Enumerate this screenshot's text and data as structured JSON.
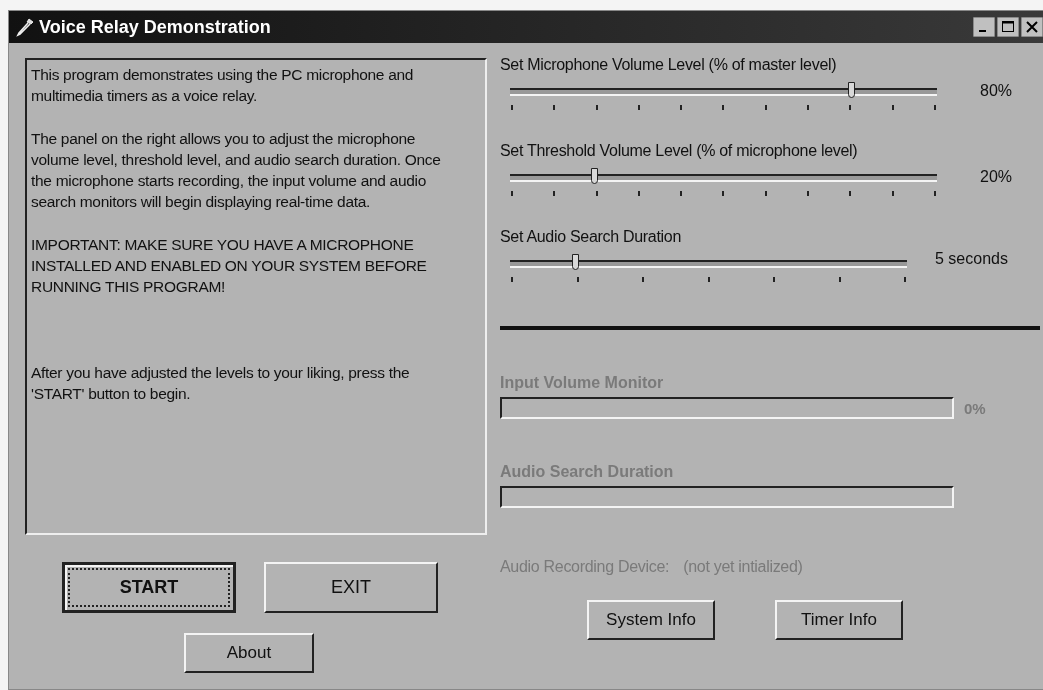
{
  "window": {
    "title": "Voice Relay Demonstration"
  },
  "description": [
    "This program demonstrates using the PC microphone and multimedia timers as a voice relay.",
    "The panel on the right allows you to adjust the microphone volume level, threshold level, and audio search duration.  Once the microphone starts recording, the input volume and audio search monitors will begin displaying real-time data.",
    "IMPORTANT:  MAKE SURE YOU HAVE A MICROPHONE INSTALLED AND ENABLED ON YOUR SYSTEM BEFORE RUNNING THIS PROGRAM!",
    "After you have adjusted the levels to your liking, press the 'START' button to begin."
  ],
  "buttons": [
    {
      "label": "START",
      "focused": true
    },
    {
      "label": "EXIT",
      "focused": false
    }
  ],
  "about_button": {
    "label": "About"
  },
  "sliders": [
    {
      "label": "Set Microphone Volume Level (% of master level)",
      "level": 0.8,
      "reading": "80%"
    },
    {
      "label": "Set Threshold Volume Level (% of microphone level)",
      "level": 0.2,
      "reading": "20%"
    },
    {
      "label": "Set Audio Search Duration",
      "level": 0.1667,
      "reading": "5 seconds"
    }
  ],
  "monitors": [
    {
      "label": "Input Volume Monitor",
      "disabled": true,
      "reading": "0%"
    },
    {
      "label": "Audio Search Duration",
      "disabled": true
    }
  ],
  "device": {
    "label": "Audio Recording Device:",
    "value": "(not yet intialized)",
    "disabled": true
  },
  "info_buttons": [
    {
      "label": "System Info"
    },
    {
      "label": "Timer Info"
    }
  ]
}
